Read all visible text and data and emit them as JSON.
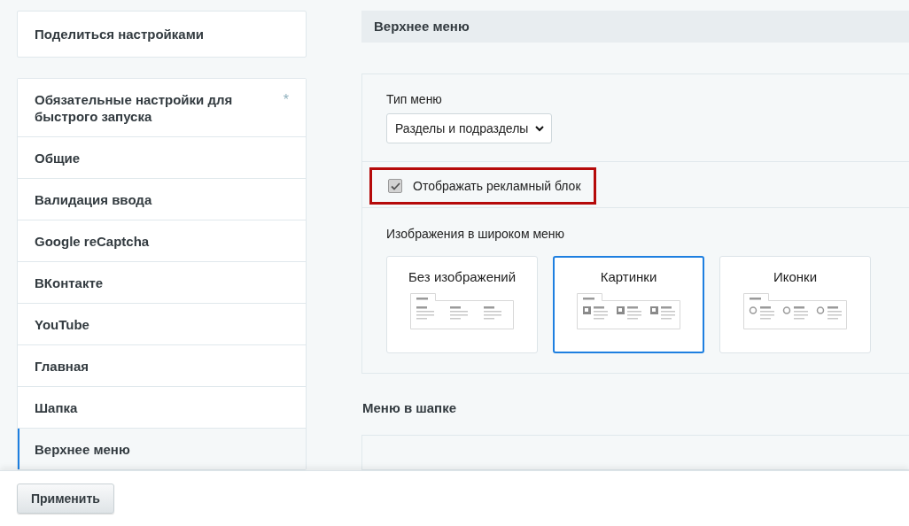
{
  "sidebar": {
    "share_item": "Поделиться настройками",
    "items": [
      {
        "label": "Обязательные настройки для быстрого запуска",
        "required_mark": "*",
        "selected": false
      },
      {
        "label": "Общие",
        "selected": false
      },
      {
        "label": "Валидация ввода",
        "selected": false
      },
      {
        "label": "Google reCaptcha",
        "selected": false
      },
      {
        "label": "ВКонтакте",
        "selected": false
      },
      {
        "label": "YouTube",
        "selected": false
      },
      {
        "label": "Главная",
        "selected": false
      },
      {
        "label": "Шапка",
        "selected": false
      },
      {
        "label": "Верхнее меню",
        "selected": true
      }
    ]
  },
  "section": {
    "title": "Верхнее меню",
    "menu_type": {
      "label": "Тип меню",
      "value": "Разделы и подразделы"
    },
    "ad_block": {
      "label": "Отображать рекламный блок",
      "checked": true,
      "highlighted": true
    },
    "images": {
      "label": "Изображения в широком меню",
      "options": [
        {
          "label": "Без изображений",
          "kind": "none",
          "selected": false
        },
        {
          "label": "Картинки",
          "kind": "pictures",
          "selected": true
        },
        {
          "label": "Иконки",
          "kind": "icons",
          "selected": false
        }
      ]
    }
  },
  "next_section": {
    "title": "Меню в шапке"
  },
  "footer": {
    "apply_button": "Применить"
  }
}
